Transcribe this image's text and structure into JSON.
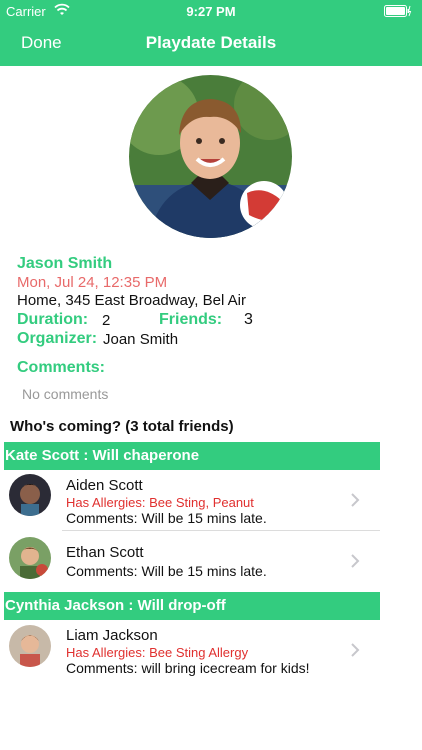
{
  "status_bar": {
    "carrier": "Carrier",
    "time": "9:27 PM"
  },
  "nav": {
    "done_label": "Done",
    "title": "Playdate Details"
  },
  "host": {
    "name": "Jason Smith",
    "date": "Mon, Jul 24, 12:35 PM",
    "address": "Home, 345 East Broadway, Bel Air",
    "duration_label": "Duration:",
    "duration_value": "2",
    "friends_label": "Friends:",
    "friends_value": "3",
    "organizer_label": "Organizer:",
    "organizer_value": "Joan Smith",
    "comments_label": "Comments:",
    "comments_value": "No comments"
  },
  "whos_coming": "Who's coming? (3 total friends)",
  "groups": [
    {
      "header": "Kate Scott : Will chaperone",
      "kids": [
        {
          "name": "Aiden Scott",
          "allergies": "Has Allergies: Bee Sting, Peanut",
          "comments": "Comments: Will be 15 mins late."
        },
        {
          "name": "Ethan Scott",
          "comments": "Comments: Will be 15 mins late."
        }
      ]
    },
    {
      "header": "Cynthia Jackson : Will drop-off",
      "kids": [
        {
          "name": "Liam Jackson",
          "allergies": "Has Allergies: Bee Sting Allergy",
          "comments": "Comments: will bring icecream for kids!"
        }
      ]
    }
  ],
  "colors": {
    "accent": "#33cc7f",
    "date": "#e86a6a",
    "allergy": "#e0302f",
    "muted": "#999999"
  },
  "icons": [
    "wifi-icon",
    "battery-icon",
    "chevron-right-icon"
  ]
}
